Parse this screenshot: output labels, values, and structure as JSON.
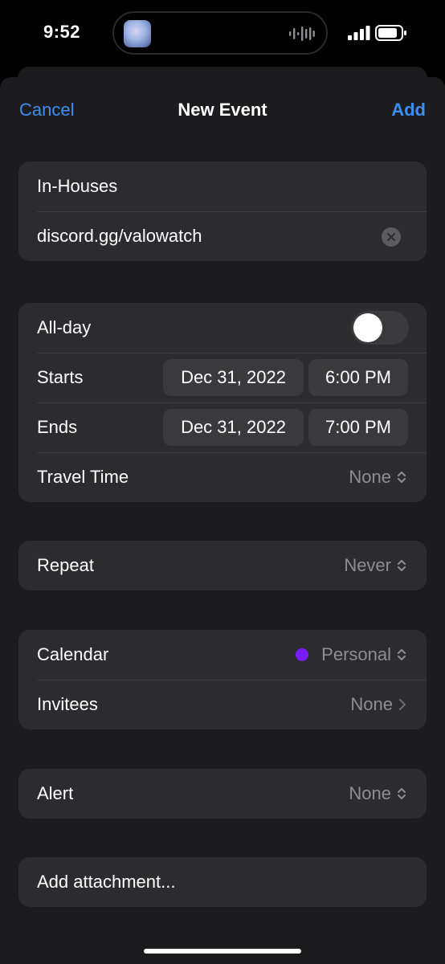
{
  "status_bar": {
    "time": "9:52"
  },
  "nav": {
    "cancel_label": "Cancel",
    "title": "New Event",
    "add_label": "Add"
  },
  "title_group": {
    "title_value": "In-Houses",
    "location_value": "discord.gg/valowatch"
  },
  "date_group": {
    "allday_label": "All-day",
    "allday_on": false,
    "starts_label": "Starts",
    "starts_date": "Dec 31, 2022",
    "starts_time": "6:00 PM",
    "ends_label": "Ends",
    "ends_date": "Dec 31, 2022",
    "ends_time": "7:00 PM",
    "travel_label": "Travel Time",
    "travel_value": "None"
  },
  "repeat_group": {
    "repeat_label": "Repeat",
    "repeat_value": "Never"
  },
  "calendar_group": {
    "calendar_label": "Calendar",
    "calendar_value": "Personal",
    "calendar_color": "#7a1cf5",
    "invitees_label": "Invitees",
    "invitees_value": "None"
  },
  "alert_group": {
    "alert_label": "Alert",
    "alert_value": "None"
  },
  "attachment": {
    "label": "Add attachment..."
  },
  "colors": {
    "accent": "#3b8ef0",
    "background": "#1c1c1e",
    "cell": "#2c2c2e"
  }
}
